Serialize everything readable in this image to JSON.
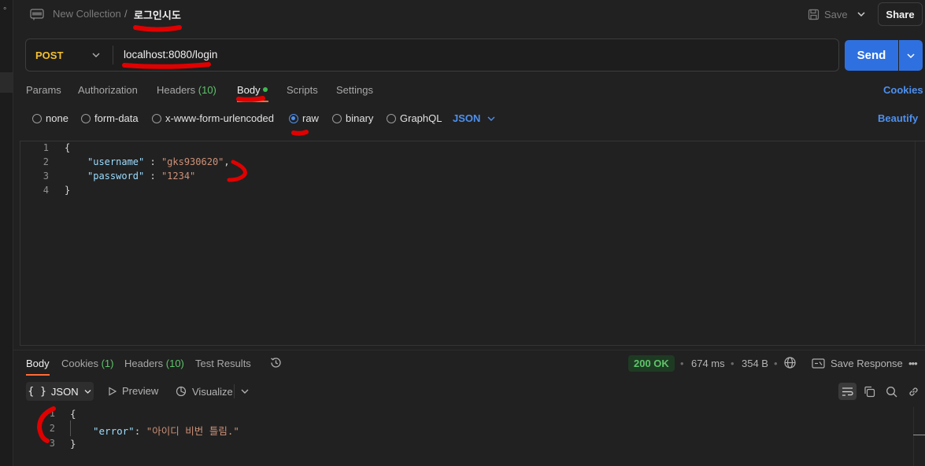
{
  "left_strip": {
    "glyph": "°"
  },
  "header": {
    "collection": "New Collection",
    "separator": "/",
    "request_name": "로그인시도",
    "save_label": "Save",
    "share_label": "Share",
    "http_icon": "http-file-icon"
  },
  "request": {
    "method": "POST",
    "url": "localhost:8080/login",
    "send_label": "Send"
  },
  "request_tabs": {
    "params": "Params",
    "authorization": "Authorization",
    "headers": "Headers",
    "headers_count": "(10)",
    "body": "Body",
    "scripts": "Scripts",
    "settings": "Settings",
    "cookies": "Cookies"
  },
  "body_types": {
    "none": "none",
    "form_data": "form-data",
    "urlencoded": "x-www-form-urlencoded",
    "raw": "raw",
    "binary": "binary",
    "graphql": "GraphQL",
    "selected": "raw",
    "format": "JSON",
    "beautify": "Beautify"
  },
  "request_body": {
    "line_numbers": [
      "1",
      "2",
      "3",
      "4"
    ],
    "open_brace": "{",
    "close_brace": "}",
    "fields": [
      {
        "key": "\"username\"",
        "value": "\"gks930620\"",
        "trail": ","
      },
      {
        "key": "\"password\"",
        "value": "\"1234\"",
        "trail": ""
      }
    ],
    "colon": " : "
  },
  "response_tabs": {
    "body": "Body",
    "cookies": "Cookies",
    "cookies_count": "(1)",
    "headers": "Headers",
    "headers_count": "(10)",
    "test_results": "Test Results"
  },
  "response_meta": {
    "status": "200 OK",
    "time": "674 ms",
    "size": "354 B",
    "bullet": "•",
    "save_response": "Save Response",
    "more": "•••"
  },
  "response_toolbar": {
    "view_icon": "{ }",
    "view_format": "JSON",
    "preview": "Preview",
    "visualize": "Visualize"
  },
  "response_body": {
    "line_numbers": [
      "1",
      "2",
      "3"
    ],
    "open_brace": "{",
    "close_brace": "}",
    "key": "\"error\"",
    "colon": ": ",
    "value": "\"아이디 비번 틀림.\""
  },
  "colors": {
    "accent_orange": "#ff6c37",
    "send_blue": "#2f70e0",
    "link_blue": "#4d90ef",
    "method_yellow": "#f4c02f",
    "status_green": "#5ec46a",
    "annotation_red": "#e00000"
  }
}
